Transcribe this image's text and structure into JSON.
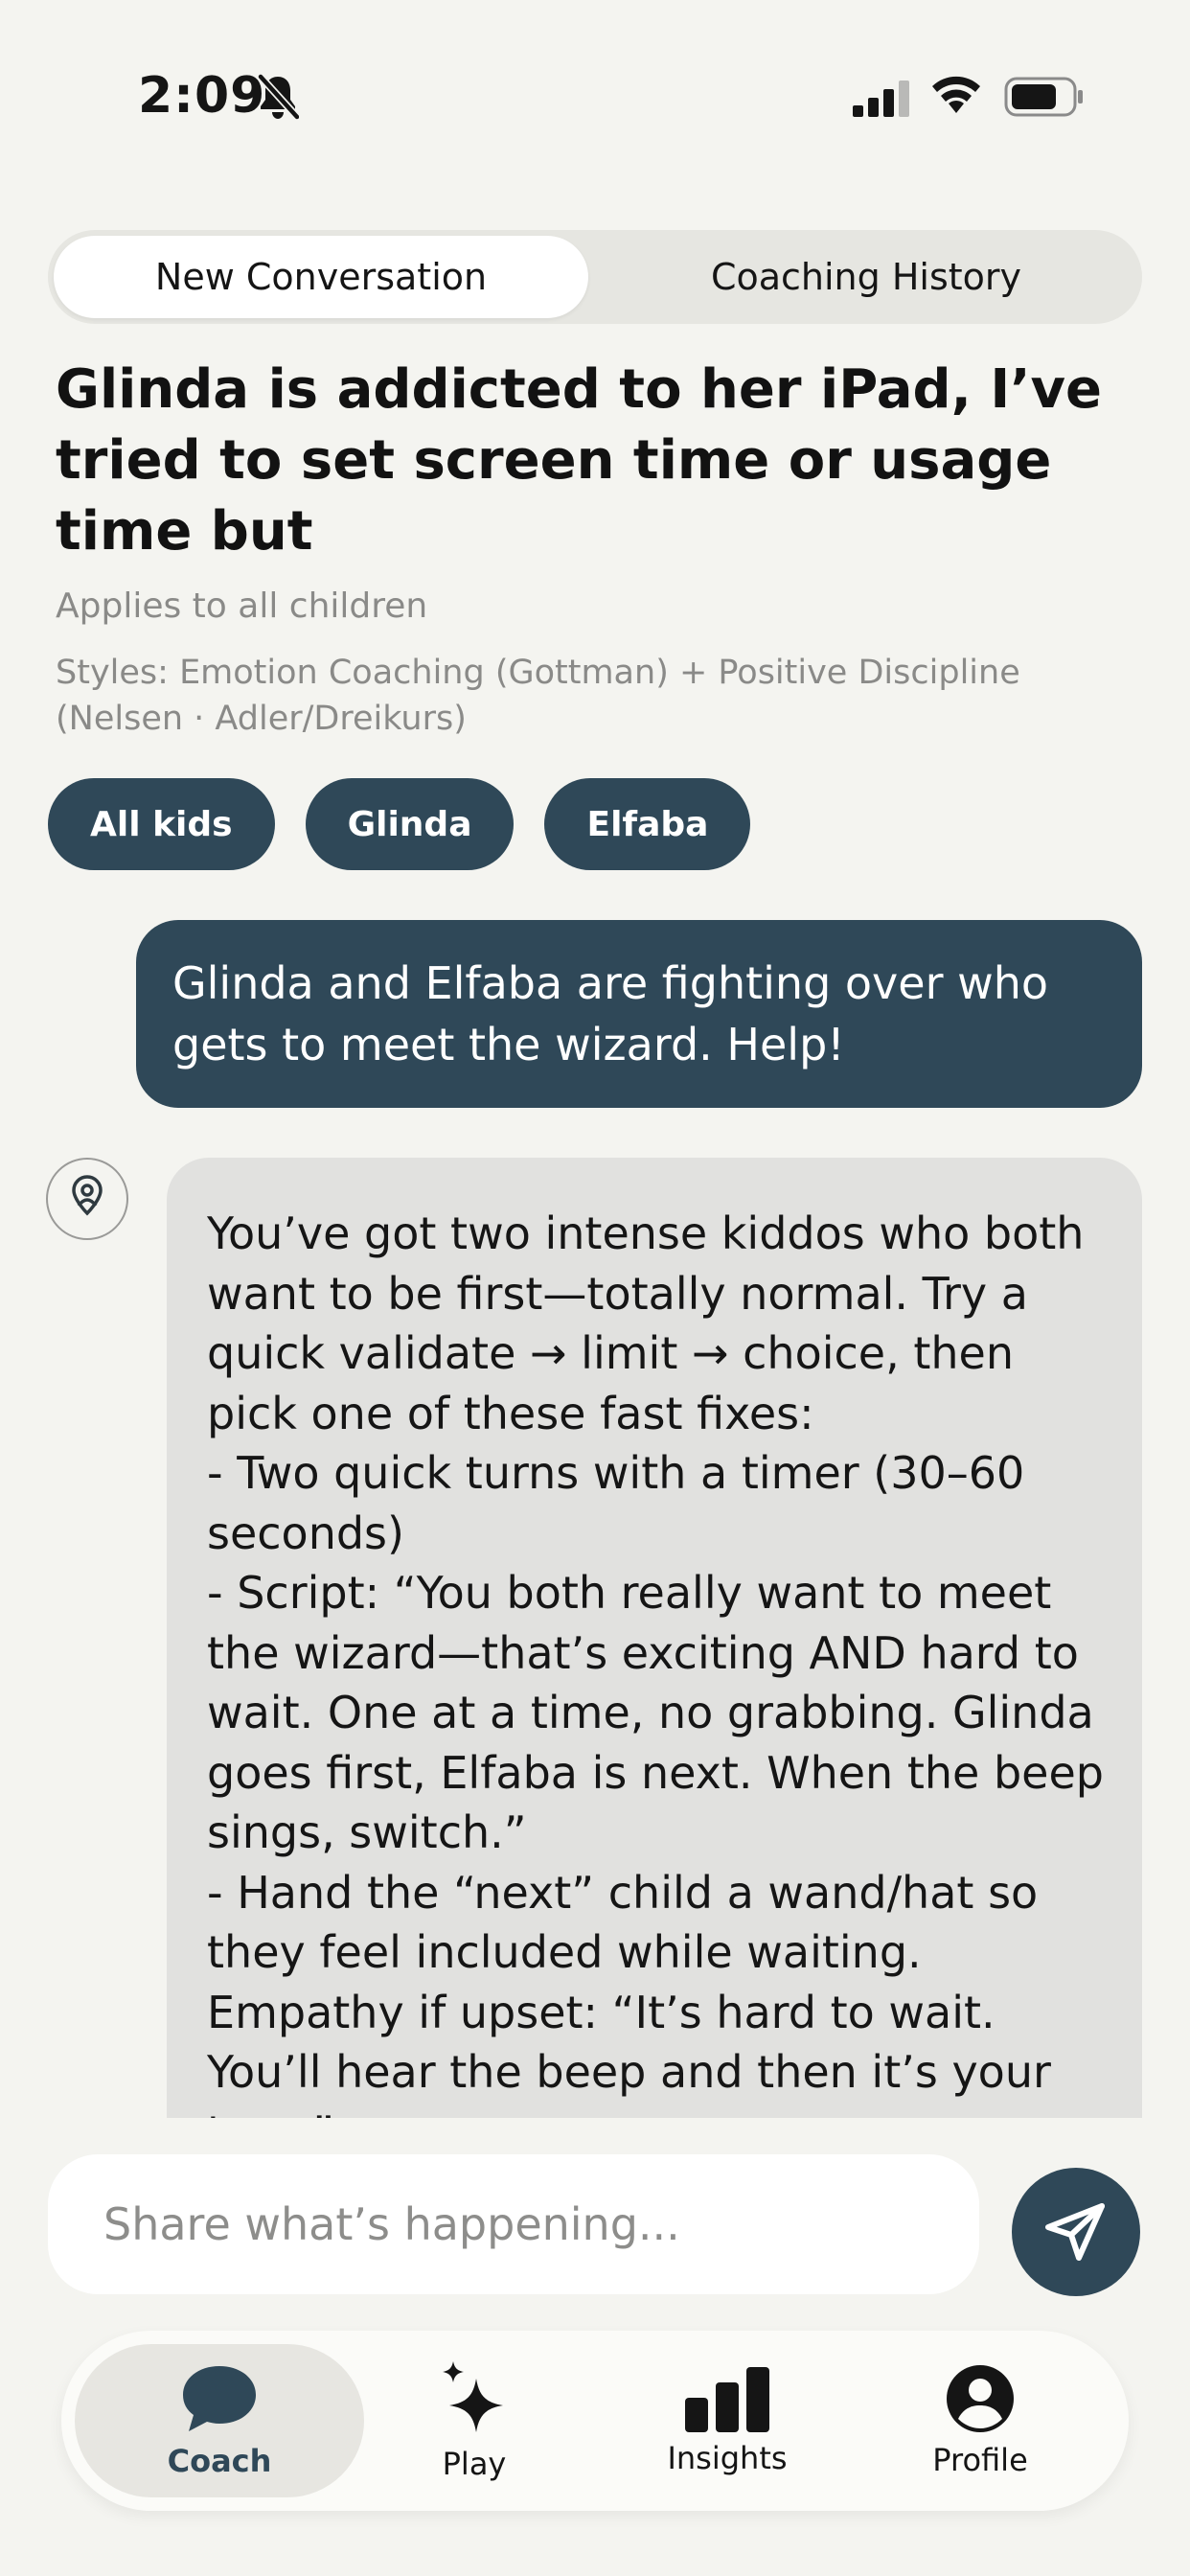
{
  "status_bar": {
    "time": "2:09",
    "icons": [
      "bell-slash-icon",
      "cellular-signal-icon",
      "wifi-icon",
      "battery-icon"
    ]
  },
  "segmented": {
    "active": "New Conversation",
    "inactive": "Coaching History"
  },
  "header": {
    "title": "Glinda is addicted to her iPad, I’ve tried to set screen time or usage time but",
    "applies": "Applies to all children",
    "styles": "Styles: Emotion Coaching (Gottman) + Positive Discipline (Nelsen · Adler/Dreikurs)"
  },
  "chips": [
    "All kids",
    "Glinda",
    "Elfaba"
  ],
  "messages": {
    "user": "Glinda and Elfaba are fighting over who gets to meet the wizard. Help!",
    "assistant": "You’ve got two intense kiddos who both want to be first—totally normal. Try a quick validate → limit → choice, then pick one of these fast fixes:\n- Two quick turns with a timer (30–60 seconds)\n- Script: “You both really want to meet the wizard—that’s exciting AND hard to wait. One at a time, no grabbing. Glinda goes first, Elfaba is next. When the beep sings, switch.”\n- Hand the “next” child a wand/hat so they feel included while waiting.\nEmpathy if upset: “It’s hard to wait. You’ll hear the beep and then it’s your turn.”"
  },
  "composer": {
    "placeholder": "Share what’s happening..."
  },
  "tabbar": {
    "tabs": [
      {
        "label": "Coach",
        "icon": "chat-bubble-icon",
        "active": true
      },
      {
        "label": "Play",
        "icon": "sparkles-icon",
        "active": false
      },
      {
        "label": "Insights",
        "icon": "bar-chart-icon",
        "active": false
      },
      {
        "label": "Profile",
        "icon": "person-circle-icon",
        "active": false
      }
    ]
  },
  "colors": {
    "accent": "#2f4858",
    "background": "#f4f4f0",
    "assistant_bubble": "#e1e1df",
    "muted_text": "#8a8a88"
  }
}
